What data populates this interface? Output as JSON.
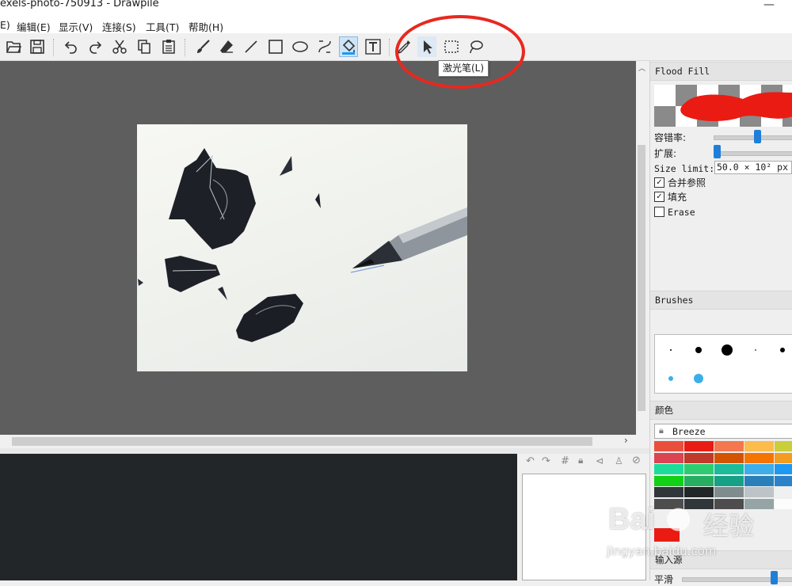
{
  "window": {
    "title": "exels-photo-750913 - Drawpile",
    "minimize_glyph": "—"
  },
  "menu": [
    {
      "label": "E)"
    },
    {
      "label": "编辑(E)"
    },
    {
      "label": "显示(V)"
    },
    {
      "label": "连接(S)"
    },
    {
      "label": "工具(T)"
    },
    {
      "label": "帮助(H)"
    }
  ],
  "tooltip": "激光笔(L)",
  "tool_settings": {
    "title": "Flood Fill",
    "tolerance_label": "容错率:",
    "tolerance_value": 0.55,
    "expand_label": "扩展:",
    "expand_value": 0.0,
    "size_limit_label": "Size limit:",
    "size_limit_value": "50.0 × 10² px",
    "merge_label": "合并参照",
    "merge_checked": true,
    "fill_label": "填充",
    "fill_checked": true,
    "erase_label": "Erase",
    "erase_checked": false
  },
  "brushes": {
    "title": "Brushes"
  },
  "colors": {
    "title": "颜色",
    "palette_name": "Breeze",
    "current": "#ea1b13",
    "swatches": [
      [
        "#e94f3d",
        "#ea1b13",
        "#f47750",
        "#fdbc4b",
        "#c9ce3b"
      ],
      [
        "#da4453",
        "#c0392b",
        "#d35400",
        "#f67400",
        "#f39c1f"
      ],
      [
        "#1cdc9a",
        "#2ecc71",
        "#1abc9c",
        "#3daee9",
        "#1d99f3"
      ],
      [
        "#11d116",
        "#27ae60",
        "#16a085",
        "#2980b9",
        "#2c82c9"
      ],
      [
        "#31363b",
        "#232629",
        "#7f8c8d",
        "#bdc3c7",
        "#eff0f1"
      ],
      [
        "#4d4d4d",
        "#31363b",
        "#4d4d4d",
        "#95a5a6",
        "#fcfcfc"
      ]
    ]
  },
  "input": {
    "title": "输入源",
    "smoothing_label": "平滑"
  },
  "watermark": {
    "brand": "Bai",
    "brand2": "经验",
    "url": "jingyan.baidu.com"
  }
}
